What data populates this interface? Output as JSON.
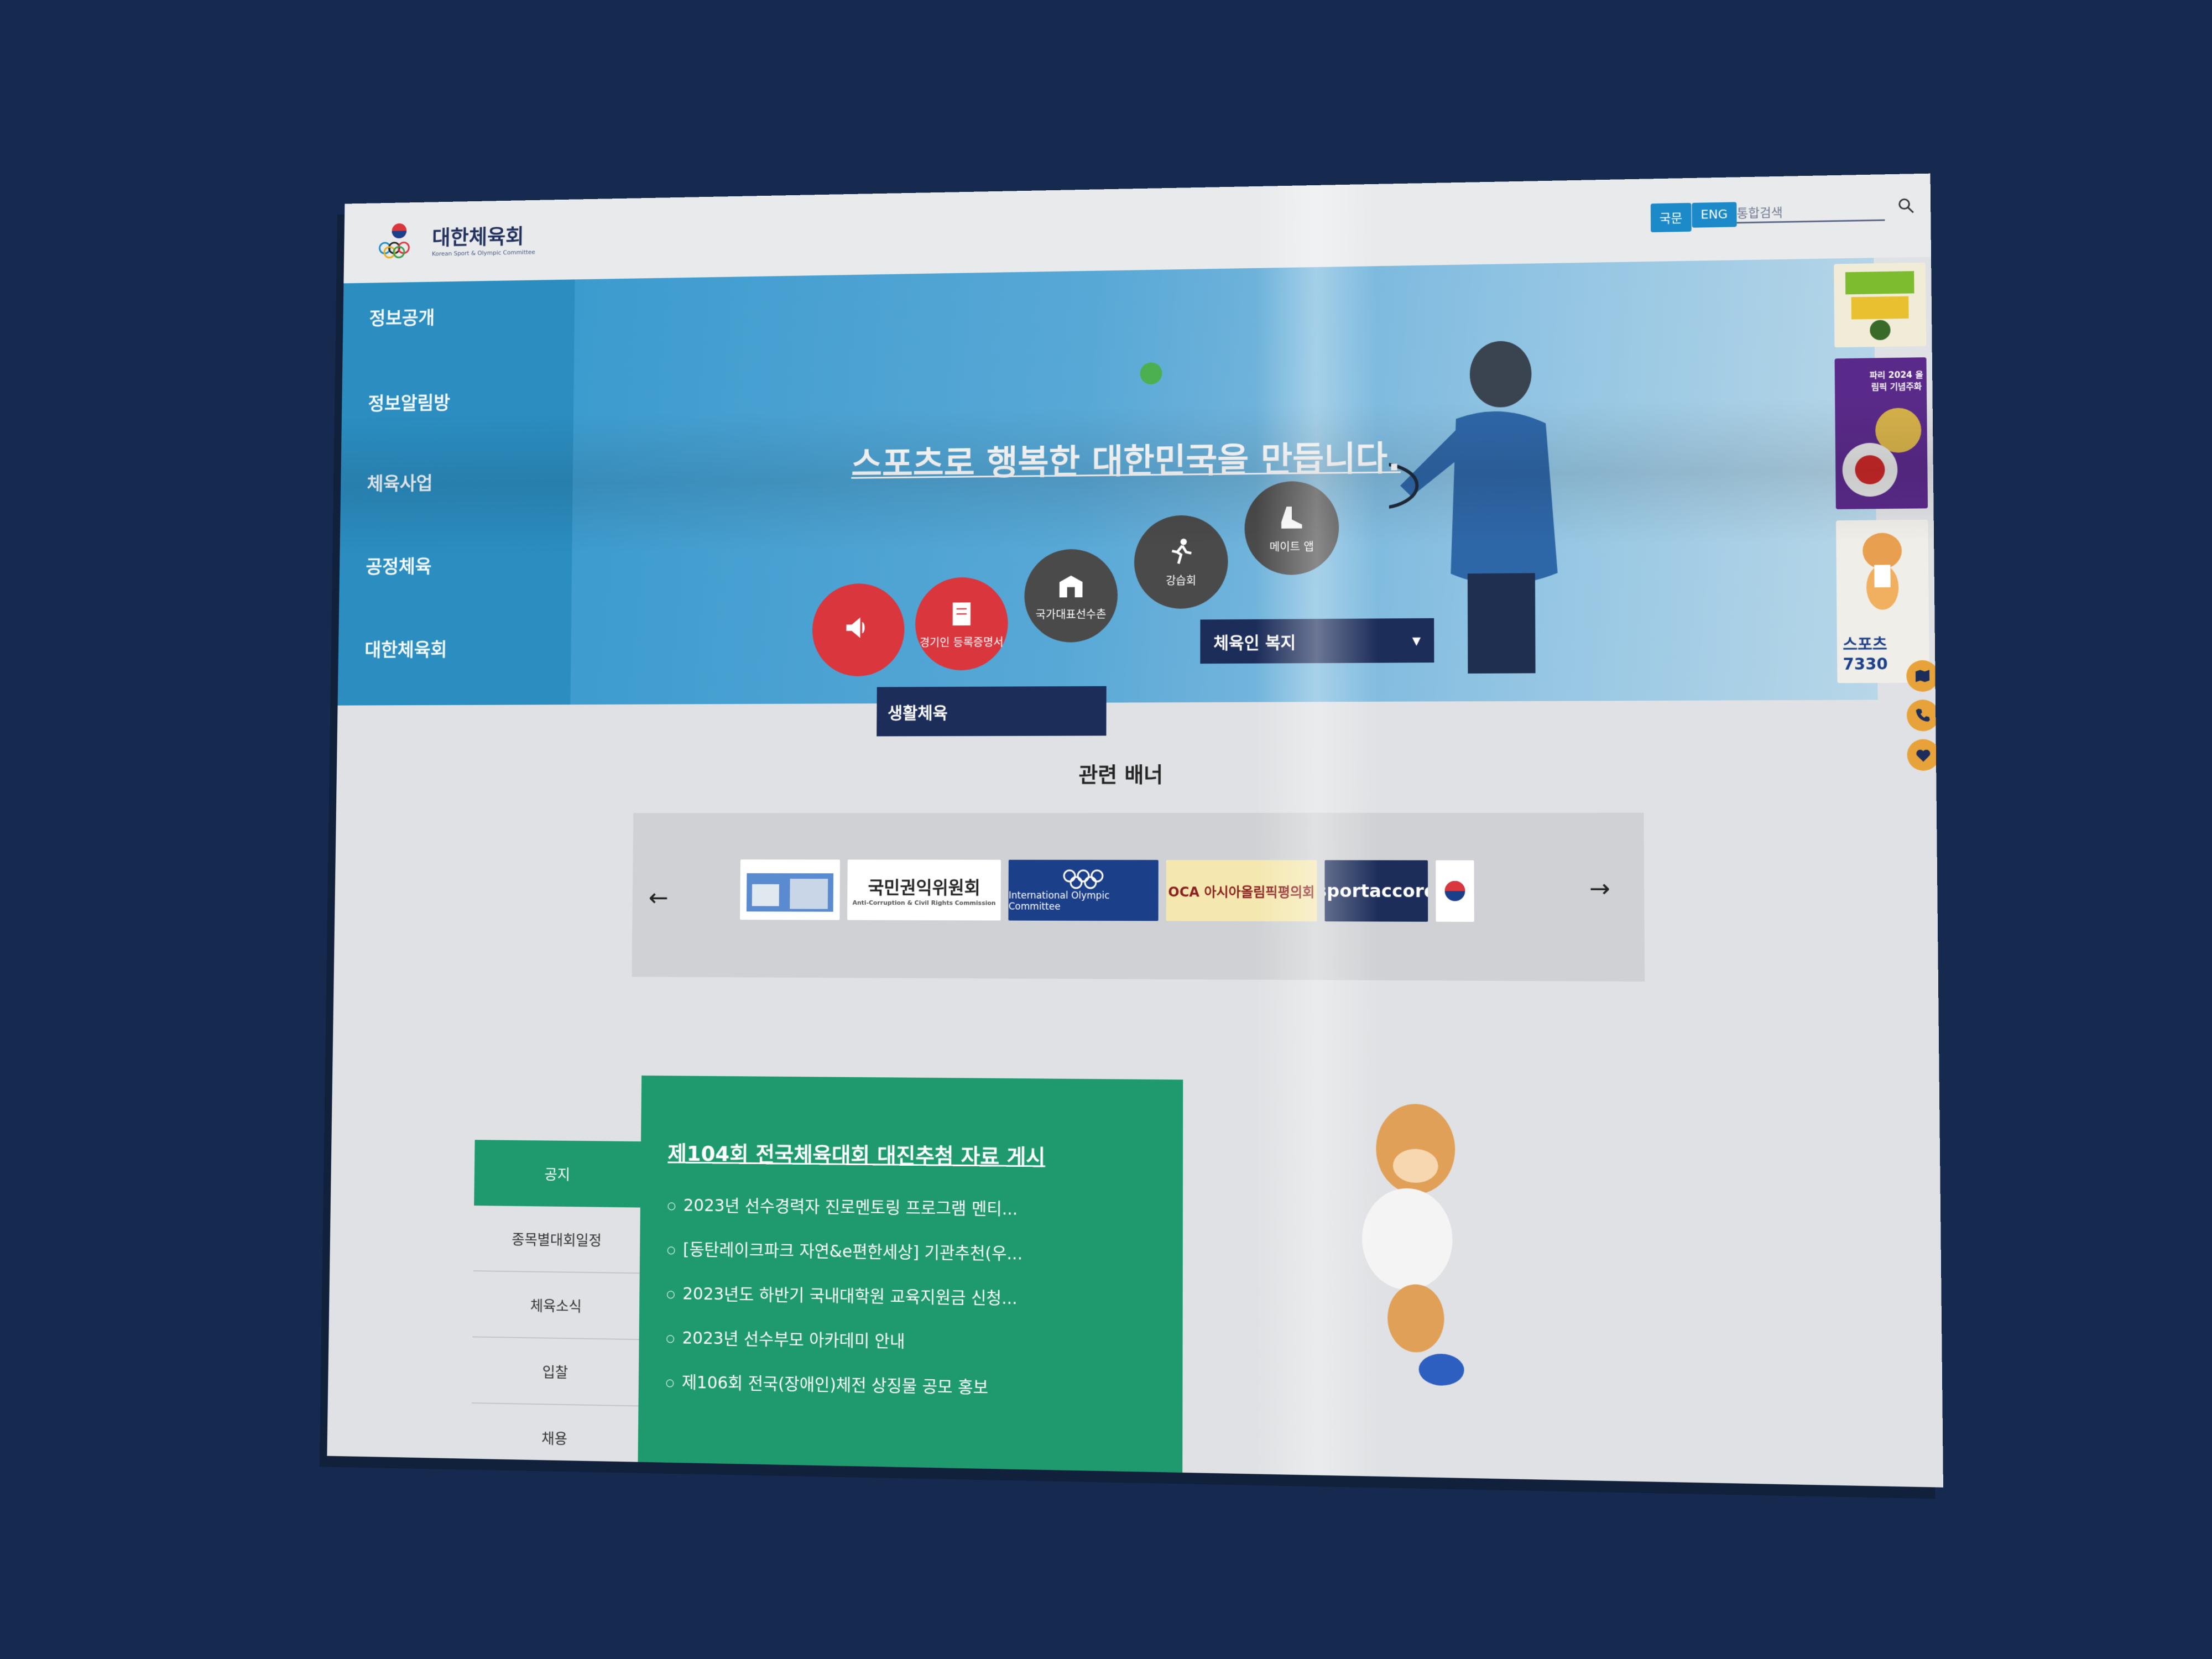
{
  "header": {
    "logo_text": "대한체육회",
    "logo_subtext": "Korean Sport & Olympic Committee",
    "lang_korean": "국문",
    "lang_english": "ENG",
    "search_placeholder": "통합검색"
  },
  "leftnav": {
    "items": [
      {
        "label": "정보공개"
      },
      {
        "label": "정보알림방"
      },
      {
        "label": "체육사업"
      },
      {
        "label": "공정체육"
      },
      {
        "label": "대한체육회"
      }
    ]
  },
  "hero": {
    "title": "스포츠로 행복한 대한민국을 만듭니다.",
    "quick_buttons": [
      {
        "label": "",
        "color": "#d9363e",
        "icon": "megaphone-icon"
      },
      {
        "label": "경기인 등록증명서",
        "color": "#d9363e",
        "icon": "certificate-icon"
      },
      {
        "label": "국가대표선수촌",
        "color": "#4a4a4a",
        "icon": "building-icon"
      },
      {
        "label": "강습회",
        "color": "#4a4a4a",
        "icon": "sport-person-icon"
      },
      {
        "label": "메이트 앱",
        "color": "#4a4a4a",
        "icon": "shoe-icon"
      }
    ],
    "welfare_label": "체육인 복지"
  },
  "side_banners": [
    {
      "label": "",
      "icon": "event-poster-icon"
    },
    {
      "label": "파리 2024 올림픽 기념주화",
      "icon": "coin-icon"
    },
    {
      "label": "스포츠7330",
      "icon": "mascot-icon"
    }
  ],
  "quick_icons": [
    "map-icon",
    "phone-icon",
    "heart-icon"
  ],
  "life_sport_label": "생활체육",
  "related": {
    "title": "관련 배너",
    "items": [
      {
        "label": "",
        "bg": "#ffffff"
      },
      {
        "label": "국민권익위원회",
        "sub": "Anti-Corruption & Civil Rights Commission",
        "bg": "#ffffff"
      },
      {
        "label": "International Olympic Committee",
        "bg": "#1c3f8a"
      },
      {
        "label": "OCA 아시아올림픽평의회",
        "bg": "#f4e8b0"
      },
      {
        "label": "sportaccord",
        "bg": "#1c2d5a"
      },
      {
        "label": "",
        "bg": "#ffffff"
      }
    ]
  },
  "notice": {
    "tabs": [
      "공지",
      "종목별대회일정",
      "체육소식",
      "입찰",
      "채용"
    ],
    "headline": "제104회 전국체육대회 대진추첨 자료 게시",
    "items": [
      "2023년 선수경력자 진로멘토링 프로그램 멘티...",
      "[동탄레이크파크 자연&e편한세상] 기관추천(우...",
      "2023년도 하반기 국내대학원 교육지원금 신청...",
      "2023년 선수부모 아카데미 안내",
      "제106회 전국(장애인)체전 상징물 공모 홍보"
    ]
  }
}
